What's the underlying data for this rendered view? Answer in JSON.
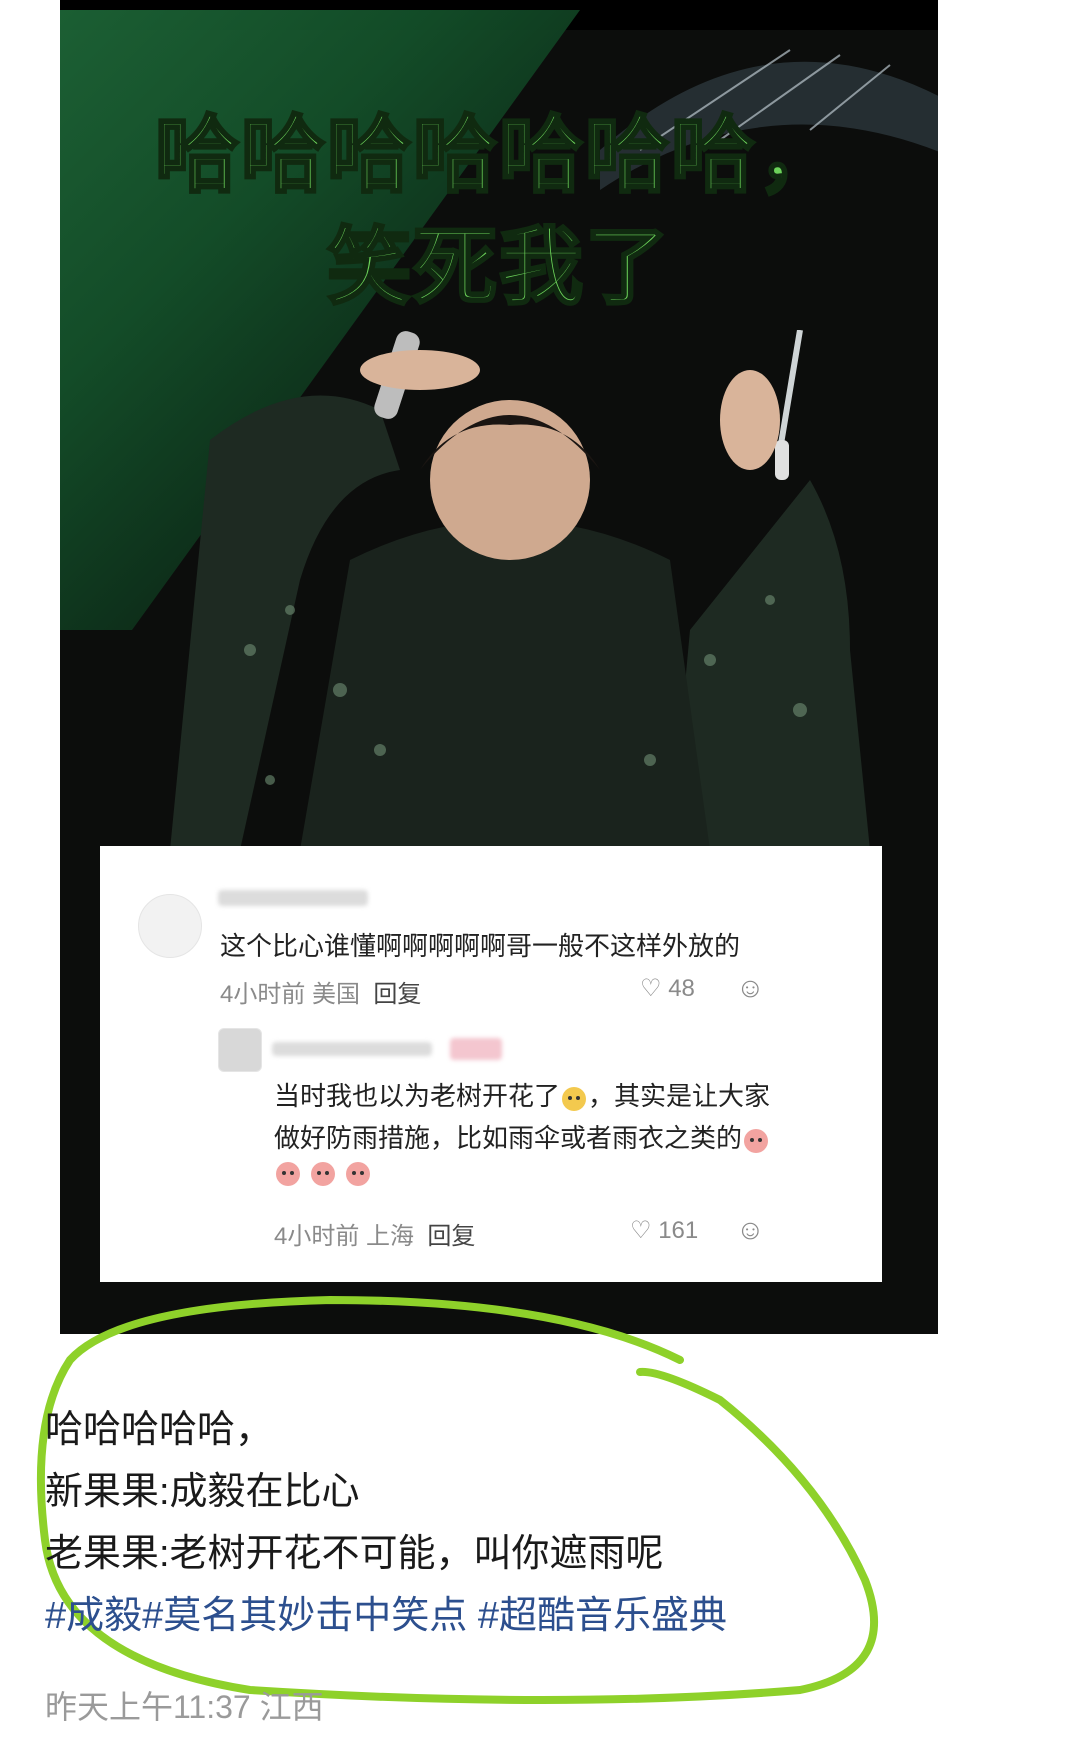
{
  "image": {
    "headline_line1": "哈哈哈哈哈哈哈，",
    "headline_line2": "笑死我了"
  },
  "comments": {
    "first": {
      "text": "这个比心谁懂啊啊啊啊啊哥一般不这样外放的",
      "time": "4小时前",
      "location": "美国",
      "reply_label": "回复",
      "likes": "48"
    },
    "second": {
      "text_line1": "当时我也以为老树开花了",
      "text_line1_rest": "，其实是让大家",
      "text_line2": "做好防雨措施，比如雨伞或者雨衣之类的",
      "time": "4小时前",
      "location": "上海",
      "reply_label": "回复",
      "likes": "161"
    }
  },
  "post": {
    "line1": "哈哈哈哈哈，",
    "line2": "新果果:成毅在比心",
    "line3": "老果果:老树开花不可能，叫你遮雨呢",
    "tags": "#成毅#莫名其妙击中笑点 #超酷音乐盛典"
  },
  "footer": {
    "timestamp": "昨天上午11:37",
    "location": "江西"
  },
  "colors": {
    "headline_green": "#6cd35a",
    "highlight_circle": "#8ed12a",
    "hashtag_blue": "#2c4f8e"
  }
}
